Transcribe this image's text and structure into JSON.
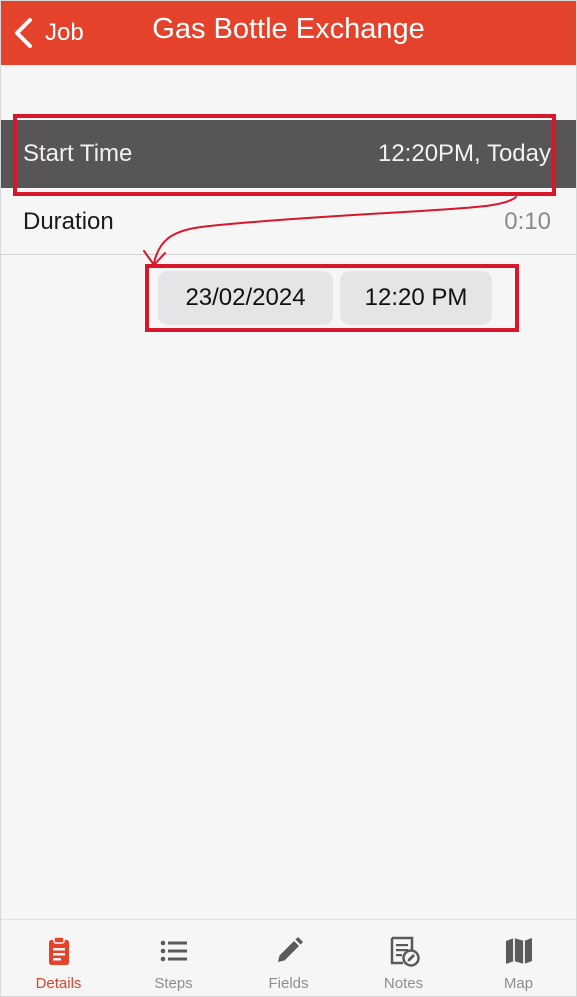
{
  "header": {
    "back_label": "Job",
    "title": "Gas Bottle Exchange",
    "color": "#e5422c"
  },
  "rows": {
    "start_time": {
      "label": "Start Time",
      "value": "12:20PM, Today",
      "selected": true
    },
    "duration": {
      "label": "Duration",
      "value": "0:10"
    }
  },
  "picker": {
    "date": "23/02/2024",
    "time": "12:20 PM"
  },
  "annotations": {
    "color": "#d8172a"
  },
  "tabs": [
    {
      "label": "Details",
      "icon": "clipboard-icon",
      "active": true
    },
    {
      "label": "Steps",
      "icon": "list-icon",
      "active": false
    },
    {
      "label": "Fields",
      "icon": "pencil-icon",
      "active": false
    },
    {
      "label": "Notes",
      "icon": "note-edit-icon",
      "active": false
    },
    {
      "label": "Map",
      "icon": "map-icon",
      "active": false
    }
  ]
}
